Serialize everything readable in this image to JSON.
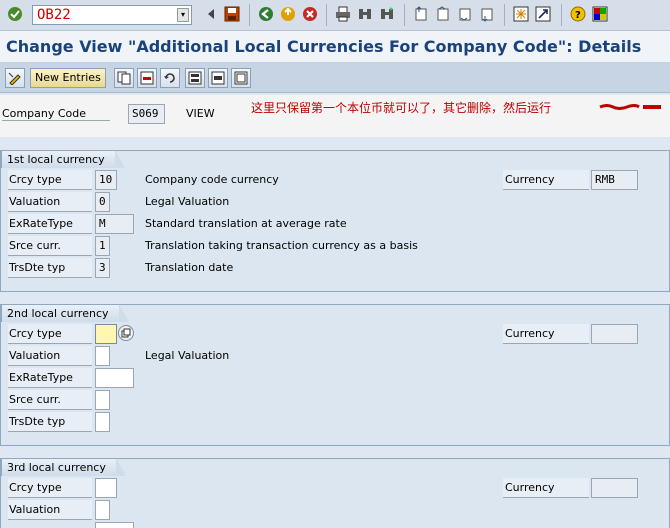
{
  "command": {
    "value": "OB22"
  },
  "title": "Change View \"Additional Local Currencies For Company Code\": Details",
  "app_toolbar": {
    "new_entries": "New Entries"
  },
  "header": {
    "company_code_label": "Company Code",
    "company_code_value": "S069",
    "view_text": "VIEW",
    "note": "这里只保留第一个本位币就可以了，其它删除，然后运行"
  },
  "groups": [
    {
      "title": "1st local currency",
      "rows": [
        {
          "label": "Crcy type",
          "value": "10",
          "desc": "Company code currency"
        },
        {
          "label": "Valuation",
          "value": "0",
          "desc": "Legal Valuation"
        },
        {
          "label": "ExRateType",
          "value": "M",
          "desc": "Standard translation at average rate"
        },
        {
          "label": "Srce curr.",
          "value": "1",
          "desc": "Translation taking transaction currency as a basis"
        },
        {
          "label": "TrsDte typ",
          "value": "3",
          "desc": "Translation date"
        }
      ],
      "currency_label": "Currency",
      "currency_value": "RMB"
    },
    {
      "title": "2nd local currency",
      "rows": [
        {
          "label": "Crcy type",
          "value": "",
          "desc": ""
        },
        {
          "label": "Valuation",
          "value": "",
          "desc": "Legal Valuation"
        },
        {
          "label": "ExRateType",
          "value": "",
          "desc": ""
        },
        {
          "label": "Srce curr.",
          "value": "",
          "desc": ""
        },
        {
          "label": "TrsDte typ",
          "value": "",
          "desc": ""
        }
      ],
      "currency_label": "Currency",
      "currency_value": ""
    },
    {
      "title": "3rd local currency",
      "rows": [
        {
          "label": "Crcy type",
          "value": "",
          "desc": ""
        },
        {
          "label": "Valuation",
          "value": "",
          "desc": ""
        }
      ],
      "currency_label": "Currency",
      "currency_value": ""
    }
  ],
  "colors": {
    "title": "#19437a",
    "note": "#c00000",
    "command_text": "#d00000"
  },
  "icons": [
    "enter-icon",
    "save-icon",
    "back-icon",
    "exit-icon",
    "cancel-icon",
    "print-icon",
    "find-icon",
    "find-next-icon",
    "first-page-icon",
    "previous-page-icon",
    "next-page-icon",
    "last-page-icon",
    "create-session-icon",
    "shortcut-icon",
    "help-icon",
    "customize-layout-icon",
    "display-change-icon",
    "copy-as-icon",
    "delete-icon",
    "undo-icon",
    "select-all-icon",
    "select-block-icon",
    "deselect-all-icon",
    "possible-entries-icon"
  ]
}
